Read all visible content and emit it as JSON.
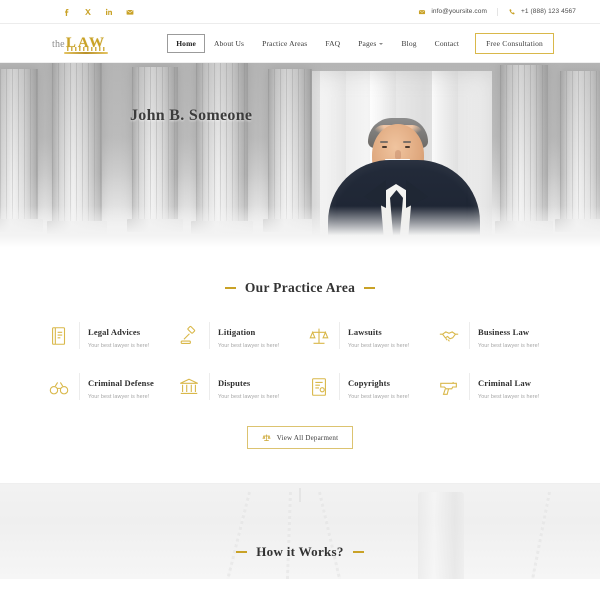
{
  "topbar": {
    "social": [
      {
        "name": "facebook-icon",
        "label": "f"
      },
      {
        "name": "twitter-x-icon",
        "label": "X"
      },
      {
        "name": "linkedin-icon",
        "label": "in"
      },
      {
        "name": "mail-icon",
        "label": ""
      }
    ],
    "email": "info@yoursite.com",
    "phone": "+1 (888) 123 4567"
  },
  "brand": {
    "the": "the",
    "law": "LAW"
  },
  "nav": {
    "items": [
      {
        "label": "Home",
        "active": true,
        "dropdown": false
      },
      {
        "label": "About Us",
        "active": false,
        "dropdown": false
      },
      {
        "label": "Practice Areas",
        "active": false,
        "dropdown": false
      },
      {
        "label": "FAQ",
        "active": false,
        "dropdown": false
      },
      {
        "label": "Pages",
        "active": false,
        "dropdown": true
      },
      {
        "label": "Blog",
        "active": false,
        "dropdown": false
      },
      {
        "label": "Contact",
        "active": false,
        "dropdown": false
      }
    ],
    "cta": "Free Consultation"
  },
  "hero": {
    "title": "John B. Someone"
  },
  "practice": {
    "heading": "Our Practice Area",
    "cards": [
      {
        "icon": "book-icon",
        "title": "Legal Advices",
        "subtitle": "Your best lawyer is here!"
      },
      {
        "icon": "gavel-icon",
        "title": "Litigation",
        "subtitle": "Your best lawyer is here!"
      },
      {
        "icon": "scales-icon",
        "title": "Lawsuits",
        "subtitle": "Your best lawyer is here!"
      },
      {
        "icon": "handshake-icon",
        "title": "Business Law",
        "subtitle": "Your best lawyer is here!"
      },
      {
        "icon": "handcuffs-icon",
        "title": "Criminal Defense",
        "subtitle": "Your best lawyer is here!"
      },
      {
        "icon": "courthouse-icon",
        "title": "Disputes",
        "subtitle": "Your best lawyer is here!"
      },
      {
        "icon": "document-icon",
        "title": "Copyrights",
        "subtitle": "Your best lawyer is here!"
      },
      {
        "icon": "gun-icon",
        "title": "Criminal Law",
        "subtitle": "Your best lawyer is here!"
      }
    ],
    "view_all": "View All Deparment",
    "view_all_icon": "scales-small-icon"
  },
  "how": {
    "heading": "How it Works?"
  },
  "colors": {
    "gold": "#c9a227",
    "gold_border": "#dcc370",
    "text_dark": "#2e2e2e",
    "text_muted": "#a5a5a5"
  }
}
